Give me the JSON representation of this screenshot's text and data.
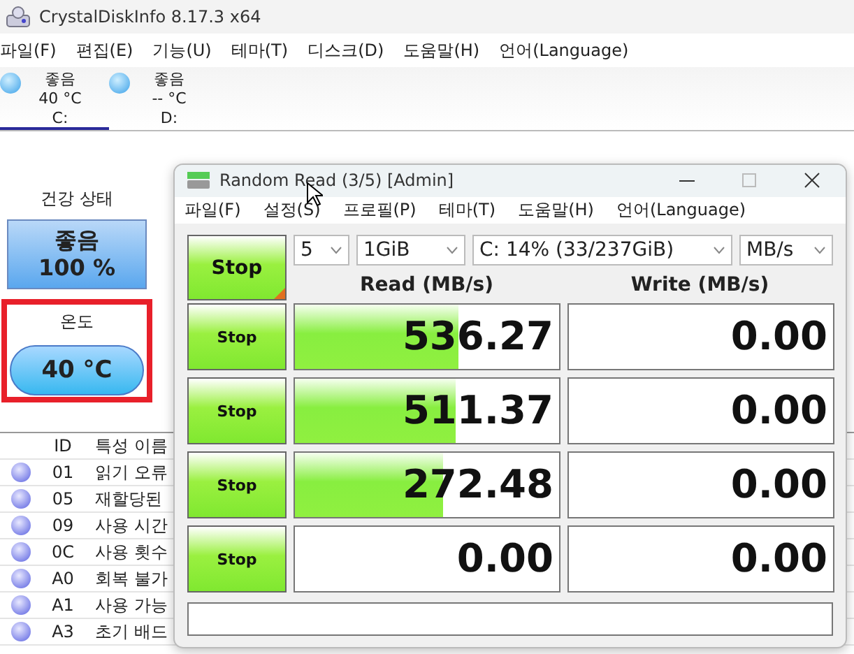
{
  "window": {
    "title": "CrystalDiskInfo 8.17.3 x64"
  },
  "menu": [
    "파일(F)",
    "편집(E)",
    "기능(U)",
    "테마(T)",
    "디스크(D)",
    "도움말(H)",
    "언어(Language)"
  ],
  "drives": [
    {
      "status": "좋음",
      "temperature": "40 °C",
      "letter": "C:",
      "selected": true
    },
    {
      "status": "좋음",
      "temperature": "-- °C",
      "letter": "D:",
      "selected": false
    }
  ],
  "health": {
    "label": "건강 상태",
    "status": "좋음",
    "percent": "100 %"
  },
  "temperature": {
    "label": "온도",
    "value": "40 °C",
    "highlighted": true
  },
  "attributes": {
    "columns": [
      "ID",
      "특성 이름"
    ],
    "rows": [
      {
        "id": "01",
        "name": "읽기 오류"
      },
      {
        "id": "05",
        "name": "재할당된"
      },
      {
        "id": "09",
        "name": "사용 시간"
      },
      {
        "id": "0C",
        "name": "사용 횟수"
      },
      {
        "id": "A0",
        "name": "회복 불가"
      },
      {
        "id": "A1",
        "name": "사용 가능"
      },
      {
        "id": "A3",
        "name": "초기 배드"
      }
    ]
  },
  "dialog": {
    "title": "Random Read (3/5) [Admin]",
    "menu": [
      "파일(F)",
      "설정(S)",
      "프로필(P)",
      "테마(T)",
      "도움말(H)",
      "언어(Language)"
    ],
    "main_button": "Stop",
    "selects": [
      "5",
      "1GiB",
      "C: 14% (33/237GiB)",
      "MB/s"
    ],
    "headers": [
      "Read (MB/s)",
      "Write (MB/s)"
    ],
    "rows": [
      {
        "button": "Stop",
        "read": {
          "value": "536.27",
          "level": 0.62
        },
        "write": {
          "value": "0.00"
        }
      },
      {
        "button": "Stop",
        "read": {
          "value": "511.37",
          "level": 0.61
        },
        "write": {
          "value": "0.00"
        }
      },
      {
        "button": "Stop",
        "read": {
          "value": "272.48",
          "level": 0.56
        },
        "write": {
          "value": "0.00"
        }
      },
      {
        "button": "Stop",
        "read": {
          "value": "0.00"
        },
        "write": {
          "value": "0.00"
        }
      }
    ]
  }
}
